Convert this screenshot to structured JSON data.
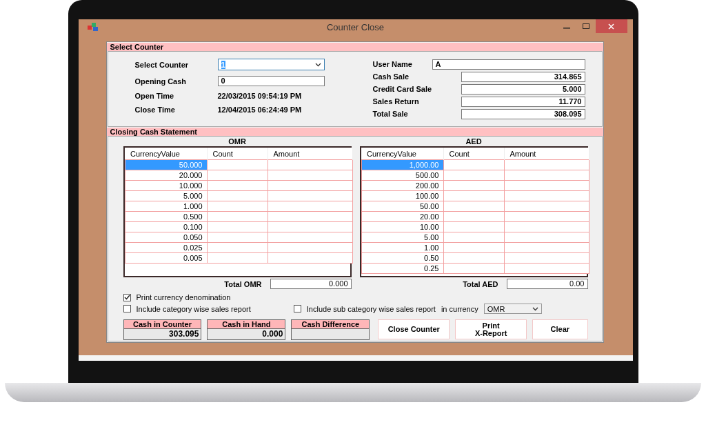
{
  "window": {
    "title": "Counter Close"
  },
  "counter_section": {
    "title": "Select Counter",
    "select_counter": {
      "label": "Select Counter",
      "value": "1"
    },
    "opening_cash": {
      "label": "Opening Cash",
      "value": "0"
    },
    "times": [
      {
        "label": "Open Time",
        "value": "22/03/2015 09:54:19 PM"
      },
      {
        "label": "Close Time",
        "value": "12/04/2015 06:24:49 PM"
      }
    ],
    "user_name": {
      "label": "User Name",
      "value": "A"
    },
    "totals": [
      {
        "label": "Cash Sale",
        "value": "314.865"
      },
      {
        "label": "Credit Card Sale",
        "value": "5.000"
      },
      {
        "label": "Sales Return",
        "value": "11.770"
      },
      {
        "label": "Total Sale",
        "value": "308.095"
      }
    ]
  },
  "cash_section": {
    "title": "Closing Cash Statement",
    "grids": [
      {
        "currency": "OMR",
        "columns": [
          "CurrencyValue",
          "Count",
          "Amount"
        ],
        "rows": [
          {
            "value": "50.000",
            "selected": true
          },
          {
            "value": "20.000",
            "selected": false
          },
          {
            "value": "10.000",
            "selected": false
          },
          {
            "value": "5.000",
            "selected": false
          },
          {
            "value": "1.000",
            "selected": false
          },
          {
            "value": "0.500",
            "selected": false
          },
          {
            "value": "0.100",
            "selected": false
          },
          {
            "value": "0.050",
            "selected": false
          },
          {
            "value": "0.025",
            "selected": false
          },
          {
            "value": "0.005",
            "selected": false
          }
        ],
        "total_label": "Total OMR",
        "total": "0.000"
      },
      {
        "currency": "AED",
        "columns": [
          "CurrencyValue",
          "Count",
          "Amount"
        ],
        "rows": [
          {
            "value": "1,000.00",
            "selected": true
          },
          {
            "value": "500.00",
            "selected": false
          },
          {
            "value": "200.00",
            "selected": false
          },
          {
            "value": "100.00",
            "selected": false
          },
          {
            "value": "50.00",
            "selected": false
          },
          {
            "value": "20.00",
            "selected": false
          },
          {
            "value": "10.00",
            "selected": false
          },
          {
            "value": "5.00",
            "selected": false
          },
          {
            "value": "1.00",
            "selected": false
          },
          {
            "value": "0.50",
            "selected": false
          },
          {
            "value": "0.25",
            "selected": false
          }
        ],
        "total_label": "Total AED",
        "total": "0.00"
      }
    ],
    "options": [
      {
        "label": "Print currency denomination",
        "checked": true
      },
      {
        "label": "Include category wise sales report",
        "checked": false
      },
      {
        "label": "Include sub category wise sales report",
        "checked": false
      }
    ],
    "currency_label": "in currency",
    "currency": "OMR",
    "summaries": [
      {
        "label": "Cash in Counter",
        "value": "303.095"
      },
      {
        "label": "Cash in Hand",
        "value": "0.000"
      },
      {
        "label": "Cash Difference"
      }
    ],
    "buttons": [
      "Close Counter",
      "Print\nX-Report",
      "Clear"
    ]
  }
}
